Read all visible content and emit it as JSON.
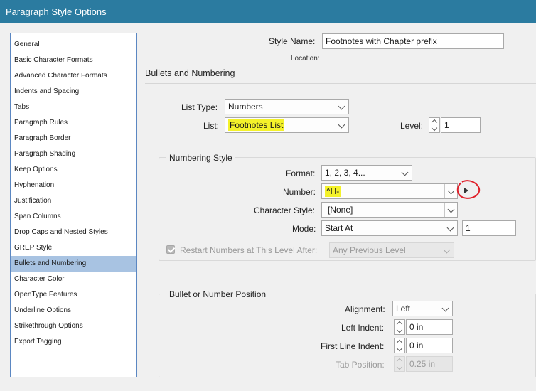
{
  "window": {
    "title": "Paragraph Style Options"
  },
  "sidebar": {
    "items": [
      {
        "label": "General"
      },
      {
        "label": "Basic Character Formats"
      },
      {
        "label": "Advanced Character Formats"
      },
      {
        "label": "Indents and Spacing"
      },
      {
        "label": "Tabs"
      },
      {
        "label": "Paragraph Rules"
      },
      {
        "label": "Paragraph Border"
      },
      {
        "label": "Paragraph Shading"
      },
      {
        "label": "Keep Options"
      },
      {
        "label": "Hyphenation"
      },
      {
        "label": "Justification"
      },
      {
        "label": "Span Columns"
      },
      {
        "label": "Drop Caps and Nested Styles"
      },
      {
        "label": "GREP Style"
      },
      {
        "label": "Bullets and Numbering",
        "selected": true
      },
      {
        "label": "Character Color"
      },
      {
        "label": "OpenType Features"
      },
      {
        "label": "Underline Options"
      },
      {
        "label": "Strikethrough Options"
      },
      {
        "label": "Export Tagging"
      }
    ]
  },
  "header": {
    "style_name_label": "Style Name:",
    "style_name_value": "Footnotes with Chapter prefix",
    "location_label": "Location:",
    "section_title": "Bullets and Numbering"
  },
  "list": {
    "list_type_label": "List Type:",
    "list_type_value": "Numbers",
    "list_label": "List:",
    "list_value": "Footnotes List",
    "level_label": "Level:",
    "level_value": "1"
  },
  "numbering_style": {
    "title": "Numbering Style",
    "format_label": "Format:",
    "format_value": "1, 2, 3, 4...",
    "number_label": "Number:",
    "number_value": "^H-",
    "character_style_label": "Character Style:",
    "character_style_value": "[None]",
    "mode_label": "Mode:",
    "mode_value": "Start At",
    "mode_start_value": "1",
    "restart_label": "Restart Numbers at This Level After:",
    "restart_value": "Any Previous Level"
  },
  "position": {
    "title": "Bullet or Number Position",
    "alignment_label": "Alignment:",
    "alignment_value": "Left",
    "left_indent_label": "Left Indent:",
    "left_indent_value": "0 in",
    "first_line_indent_label": "First Line Indent:",
    "first_line_indent_value": "0 in",
    "tab_position_label": "Tab Position:",
    "tab_position_value": "0.25 in"
  },
  "colors": {
    "titlebar": "#2b7ba0",
    "selection": "#a8c3e2",
    "highlight": "#f4f22a",
    "annotation": "#e0202a"
  }
}
